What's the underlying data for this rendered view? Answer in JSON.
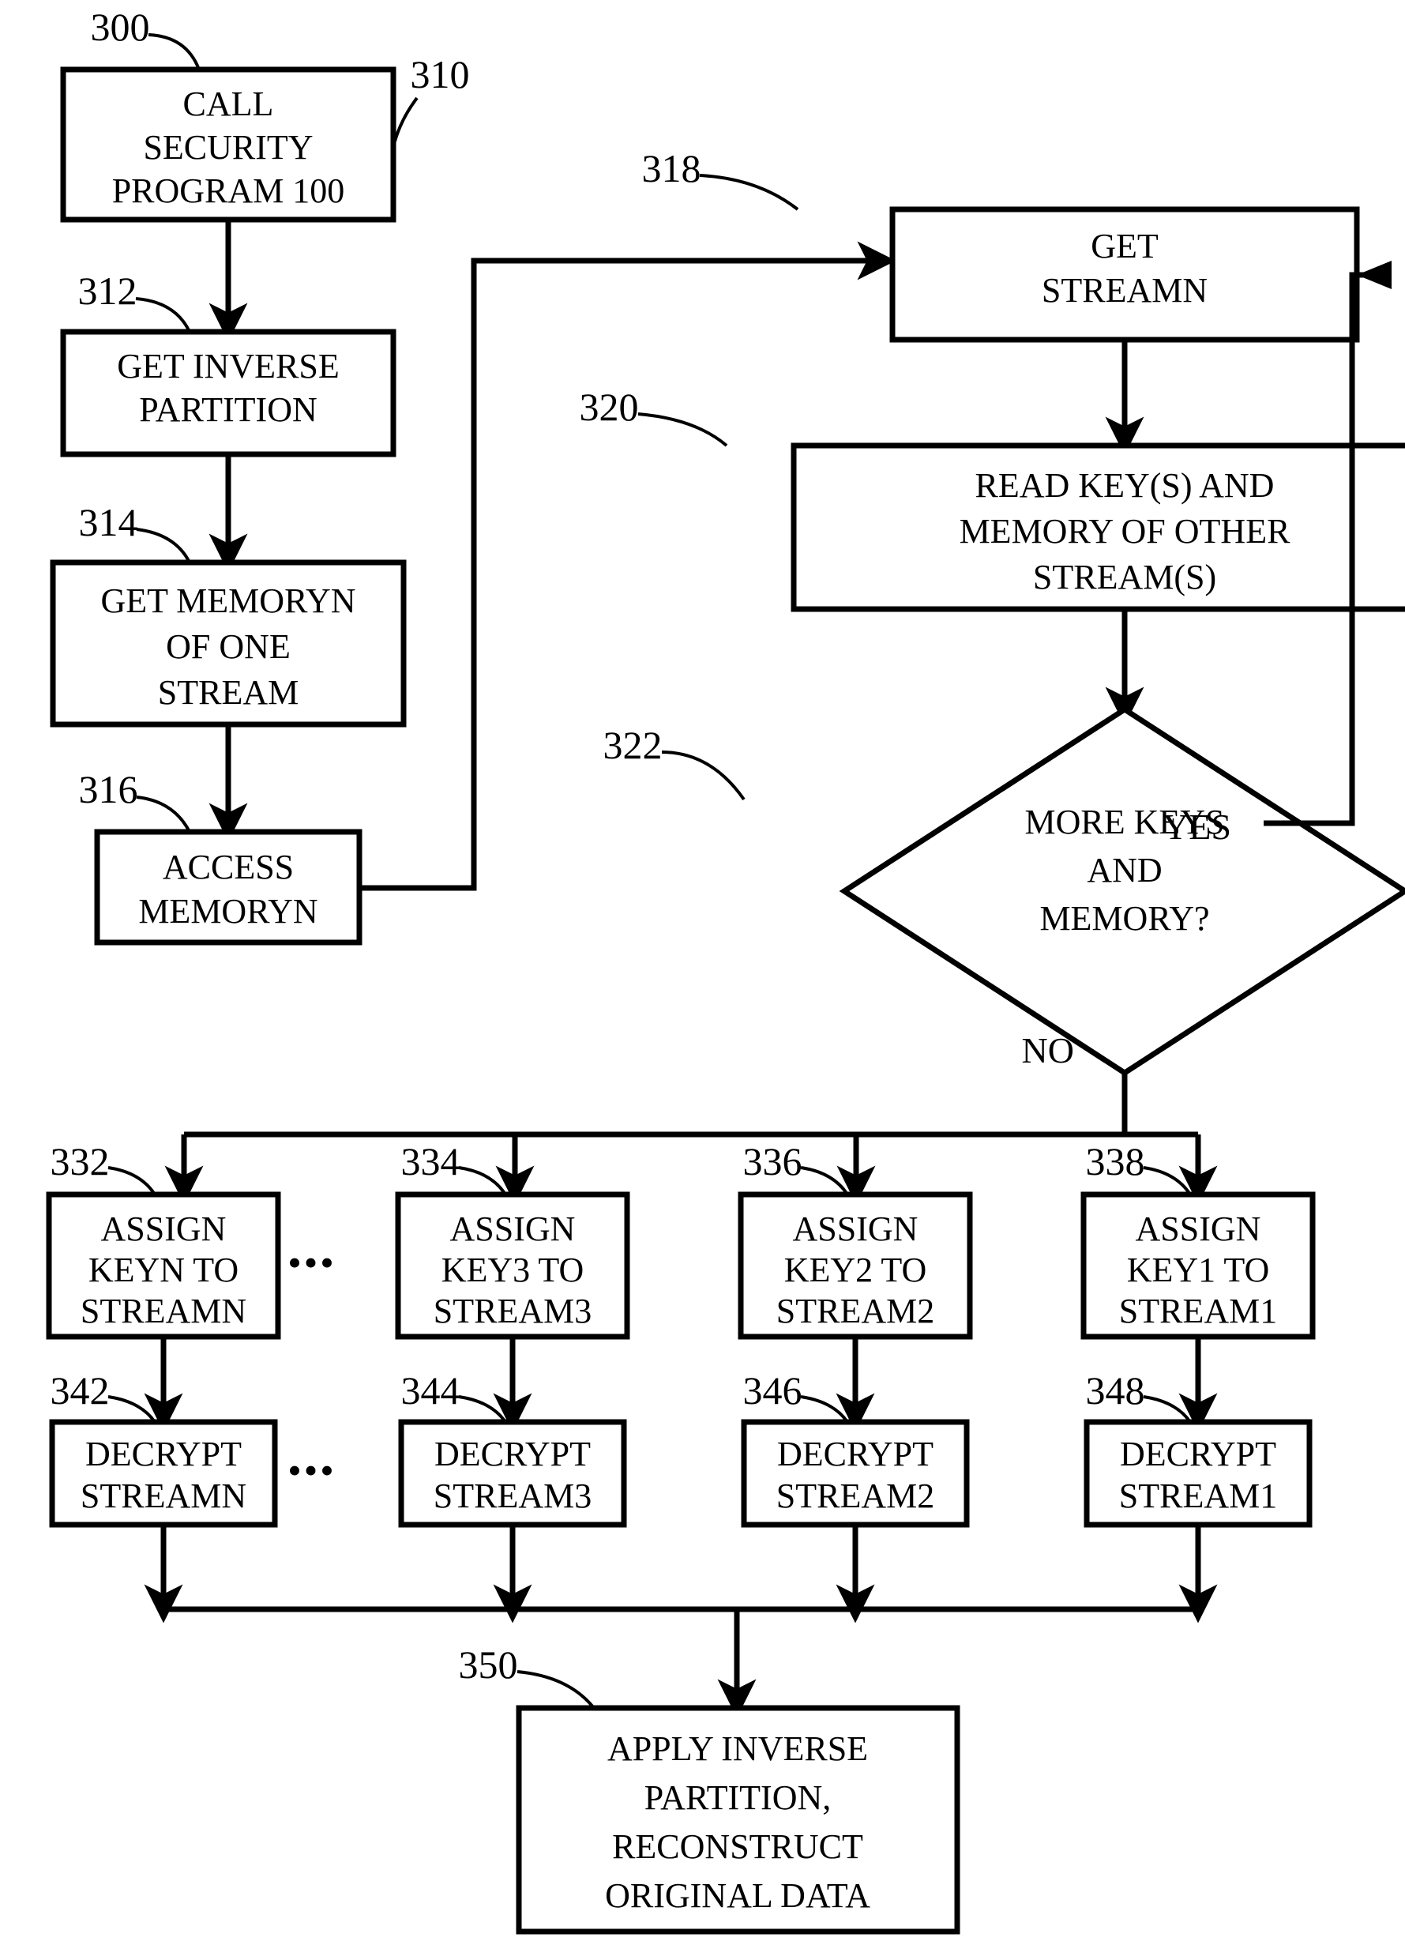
{
  "figure": {
    "type": "patent-flowchart",
    "background_color": "#ffffff",
    "line_color": "#000000"
  },
  "nodes": [
    {
      "ref": "310",
      "name": "call-security-program",
      "shape": "rect",
      "lines": [
        "CALL",
        "SECURITY",
        "PROGRAM 100"
      ]
    },
    {
      "ref": "312",
      "name": "get-inverse-partition",
      "shape": "rect",
      "lines": [
        "GET INVERSE",
        "PARTITION"
      ]
    },
    {
      "ref": "314",
      "name": "get-memoryn-of-one-stream",
      "shape": "rect",
      "lines": [
        "GET MEMORYN",
        "OF ONE",
        "STREAM"
      ]
    },
    {
      "ref": "316",
      "name": "access-memoryn",
      "shape": "rect",
      "lines": [
        "ACCESS",
        "MEMORYN"
      ]
    },
    {
      "ref": "318",
      "name": "get-streamn",
      "shape": "rect",
      "lines": [
        "GET",
        "STREAMN"
      ]
    },
    {
      "ref": "320",
      "name": "read-keys-and-memory",
      "shape": "rect",
      "lines": [
        "READ KEY(S) AND",
        "MEMORY OF OTHER",
        "STREAM(S)"
      ]
    },
    {
      "ref": "322",
      "name": "more-keys-and-memory-decision",
      "shape": "diamond",
      "lines": [
        "MORE KEYS",
        "AND",
        "MEMORY?"
      ]
    },
    {
      "ref": "332",
      "name": "assign-keyn-to-streamn",
      "shape": "rect",
      "lines": [
        "ASSIGN",
        "KEYN TO",
        "STREAMN"
      ]
    },
    {
      "ref": "334",
      "name": "assign-key3-to-stream3",
      "shape": "rect",
      "lines": [
        "ASSIGN",
        "KEY3 TO",
        "STREAM3"
      ]
    },
    {
      "ref": "336",
      "name": "assign-key2-to-stream2",
      "shape": "rect",
      "lines": [
        "ASSIGN",
        "KEY2 TO",
        "STREAM2"
      ]
    },
    {
      "ref": "338",
      "name": "assign-key1-to-stream1",
      "shape": "rect",
      "lines": [
        "ASSIGN",
        "KEY1 TO",
        "STREAM1"
      ]
    },
    {
      "ref": "342",
      "name": "decrypt-streamn",
      "shape": "rect",
      "lines": [
        "DECRYPT",
        "STREAMN"
      ]
    },
    {
      "ref": "344",
      "name": "decrypt-stream3",
      "shape": "rect",
      "lines": [
        "DECRYPT",
        "STREAM3"
      ]
    },
    {
      "ref": "346",
      "name": "decrypt-stream2",
      "shape": "rect",
      "lines": [
        "DECRYPT",
        "STREAM2"
      ]
    },
    {
      "ref": "348",
      "name": "decrypt-stream1",
      "shape": "rect",
      "lines": [
        "DECRYPT",
        "STREAM1"
      ]
    },
    {
      "ref": "350",
      "name": "apply-inverse-partition-reconstruct",
      "shape": "rect",
      "lines": [
        "APPLY INVERSE",
        "PARTITION,",
        "RECONSTRUCT",
        "ORIGINAL DATA"
      ]
    }
  ],
  "ref_numbers": {
    "n300": "300",
    "n310": "310",
    "n312": "312",
    "n314": "314",
    "n316": "316",
    "n318": "318",
    "n320": "320",
    "n322": "322",
    "n332": "332",
    "n334": "334",
    "n336": "336",
    "n338": "338",
    "n342": "342",
    "n344": "344",
    "n346": "346",
    "n348": "348",
    "n350": "350"
  },
  "branch_labels": {
    "yes": "YES",
    "no": "NO"
  },
  "ellipsis": {
    "assign_row": "•••",
    "decrypt_row": "•••"
  },
  "node_text": {
    "b310": {
      "l1": "CALL",
      "l2": "SECURITY",
      "l3": "PROGRAM 100"
    },
    "b312": {
      "l1": "GET INVERSE",
      "l2": "PARTITION"
    },
    "b314": {
      "l1": "GET MEMORYN",
      "l2": "OF ONE",
      "l3": "STREAM"
    },
    "b316": {
      "l1": "ACCESS",
      "l2": "MEMORYN"
    },
    "b318": {
      "l1": "GET",
      "l2": "STREAMN"
    },
    "b320": {
      "l1": "READ KEY(S) AND",
      "l2": "MEMORY OF OTHER",
      "l3": "STREAM(S)"
    },
    "b322": {
      "l1": "MORE KEYS",
      "l2": "AND",
      "l3": "MEMORY?"
    },
    "b332": {
      "l1": "ASSIGN",
      "l2": "KEYN TO",
      "l3": "STREAMN"
    },
    "b334": {
      "l1": "ASSIGN",
      "l2": "KEY3 TO",
      "l3": "STREAM3"
    },
    "b336": {
      "l1": "ASSIGN",
      "l2": "KEY2 TO",
      "l3": "STREAM2"
    },
    "b338": {
      "l1": "ASSIGN",
      "l2": "KEY1 TO",
      "l3": "STREAM1"
    },
    "b342": {
      "l1": "DECRYPT",
      "l2": "STREAMN"
    },
    "b344": {
      "l1": "DECRYPT",
      "l2": "STREAM3"
    },
    "b346": {
      "l1": "DECRYPT",
      "l2": "STREAM2"
    },
    "b348": {
      "l1": "DECRYPT",
      "l2": "STREAM1"
    },
    "b350": {
      "l1": "APPLY INVERSE",
      "l2": "PARTITION,",
      "l3": "RECONSTRUCT",
      "l4": "ORIGINAL DATA"
    }
  }
}
